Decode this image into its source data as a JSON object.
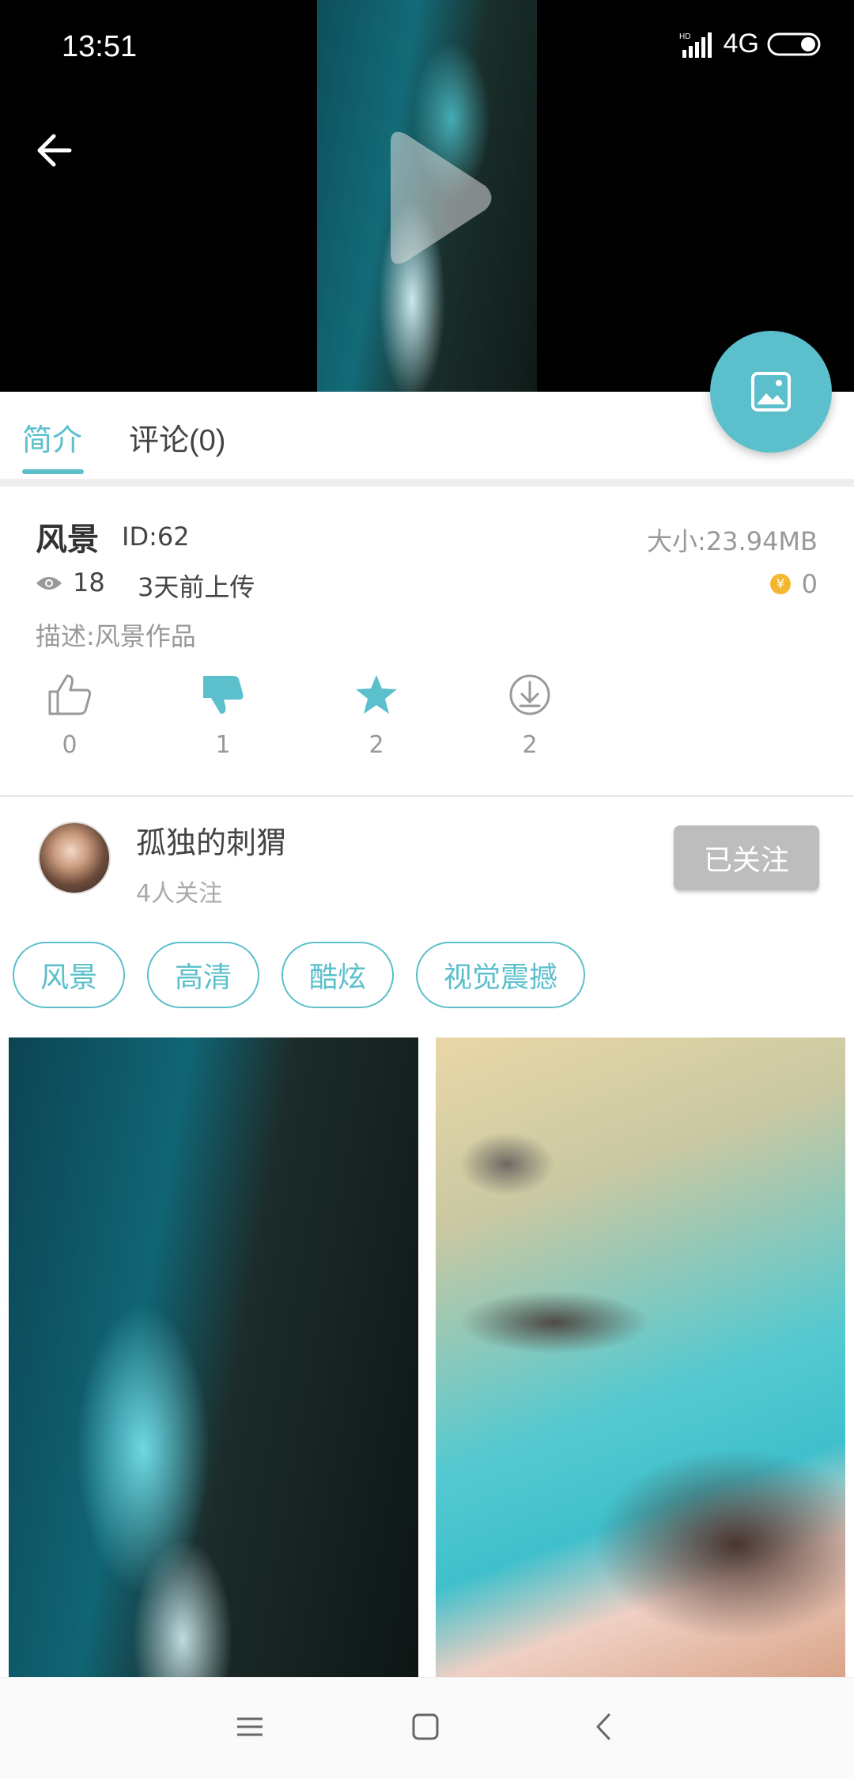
{
  "status_bar": {
    "time": "13:51",
    "network": "4G",
    "signal_label": "HD"
  },
  "video": {
    "play_icon": "play-icon",
    "back_icon": "arrow-left-icon"
  },
  "fab": {
    "icon": "image-icon"
  },
  "tabs": [
    {
      "label": "简介",
      "active": true
    },
    {
      "label": "评论(0)",
      "active": false
    }
  ],
  "info": {
    "title": "风景",
    "id_text": "ID:62",
    "size_text": "大小:23.94MB",
    "views": "18",
    "uploaded": "3天前上传",
    "coins": "0",
    "description": "描述:风景作品"
  },
  "actions": {
    "like_count": "0",
    "dislike_count": "1",
    "favorite_count": "2",
    "download_count": "2"
  },
  "author": {
    "name": "孤独的刺猬",
    "followers": "4人关注",
    "follow_label": "已关注"
  },
  "tags": [
    "风景",
    "高清",
    "酷炫",
    "视觉震撼"
  ],
  "colors": {
    "accent": "#5bbfcc",
    "gold": "#f5b731",
    "follow_bg": "#bdbdbd"
  }
}
